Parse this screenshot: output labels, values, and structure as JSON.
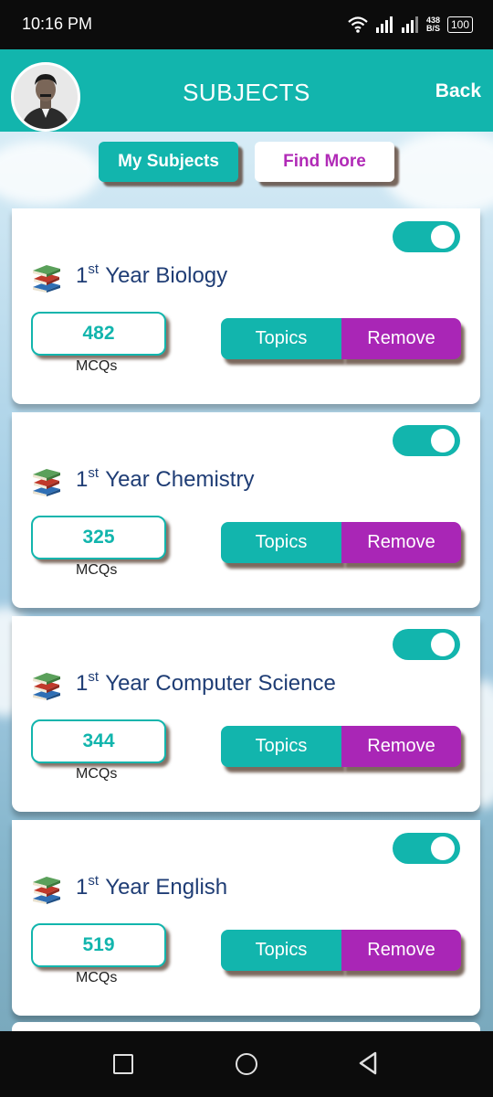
{
  "status_bar": {
    "time": "10:16 PM",
    "net_speed_value": "438",
    "net_speed_unit": "B/S",
    "battery": "100"
  },
  "header": {
    "title": "SUBJECTS",
    "back_label": "Back"
  },
  "tabs": {
    "my_subjects": "My Subjects",
    "find_more": "Find More",
    "active": "My Subjects"
  },
  "subjects": [
    {
      "year": "1",
      "year_suffix": "st",
      "name": "Year Biology",
      "mcq_count": "482",
      "count_label": "MCQs",
      "topics_label": "Topics",
      "remove_label": "Remove",
      "enabled": true
    },
    {
      "year": "1",
      "year_suffix": "st",
      "name": "Year Chemistry",
      "mcq_count": "325",
      "count_label": "MCQs",
      "topics_label": "Topics",
      "remove_label": "Remove",
      "enabled": true
    },
    {
      "year": "1",
      "year_suffix": "st",
      "name": "Year Computer Science",
      "mcq_count": "344",
      "count_label": "MCQs",
      "topics_label": "Topics",
      "remove_label": "Remove",
      "enabled": true
    },
    {
      "year": "1",
      "year_suffix": "st",
      "name": "Year English",
      "mcq_count": "519",
      "count_label": "MCQs",
      "topics_label": "Topics",
      "remove_label": "Remove",
      "enabled": true
    }
  ],
  "icons": {
    "subject_icon": "books-icon",
    "nav": [
      "recent-apps-icon",
      "home-icon",
      "back-triangle-icon"
    ]
  },
  "colors": {
    "primary": "#12b5ad",
    "accent": "#a926b6",
    "subject_text": "#1f3d75"
  }
}
